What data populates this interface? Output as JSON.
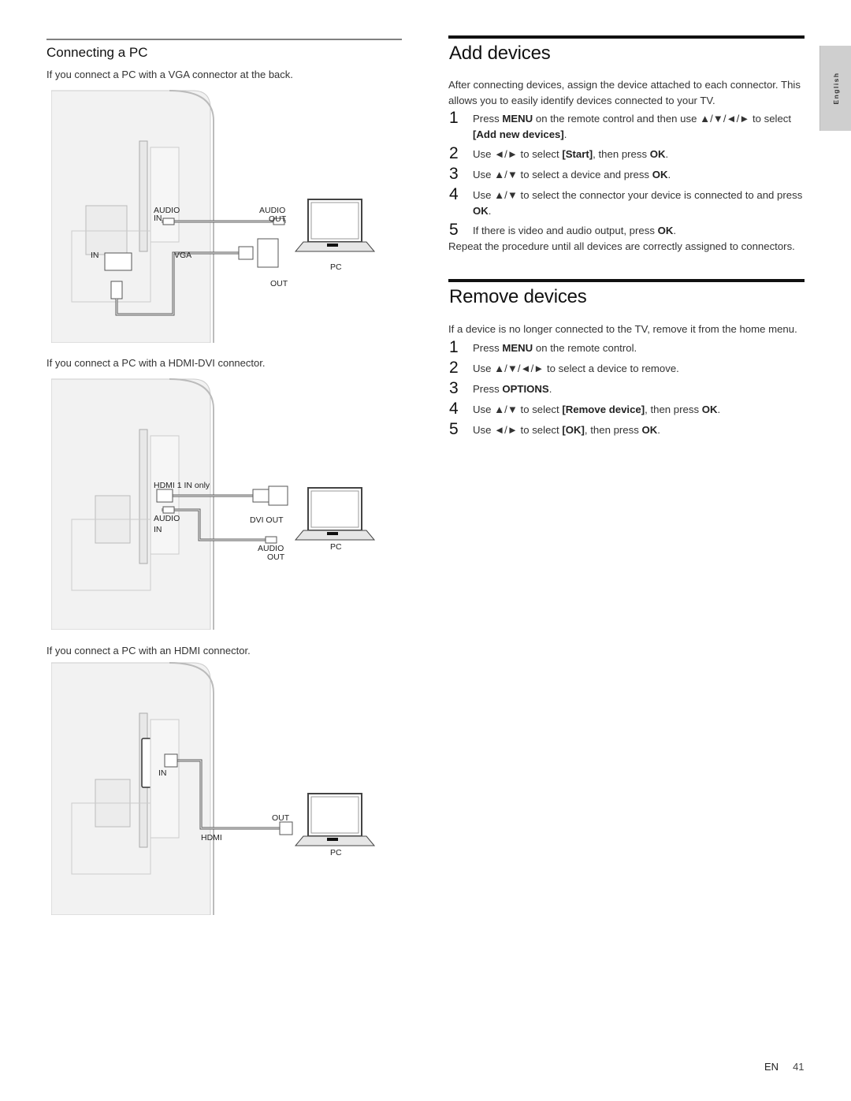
{
  "left": {
    "heading": "Connecting a PC",
    "diagrams": [
      {
        "caption": "If you connect a PC with a VGA connector at the back.",
        "labels": {
          "audio_in_1": "AUDIO",
          "audio_in_2": "IN",
          "audio_out_1": "AUDIO",
          "audio_out_2": "OUT",
          "in": "IN",
          "vga": "VGA",
          "out": "OUT",
          "pc": "PC"
        }
      },
      {
        "caption": "If you connect a PC with a HDMI-DVI connector.",
        "labels": {
          "hdmi": "HDMI 1 IN only",
          "dvi_out": "DVI OUT",
          "audio_in_1": "AUDIO",
          "audio_in_2": "IN",
          "audio_out_1": "AUDIO",
          "audio_out_2": "OUT",
          "pc": "PC"
        }
      },
      {
        "caption": "If you connect a PC with an HDMI connector.",
        "labels": {
          "in": "IN",
          "out": "OUT",
          "hdmi": "HDMI",
          "pc": "PC"
        }
      }
    ]
  },
  "add_devices": {
    "title": "Add devices",
    "intro": "After connecting devices, assign the device attached to each connector. This allows you to easily identify devices connected to your TV.",
    "steps": [
      {
        "num": "1",
        "parts": [
          [
            "t",
            "Press "
          ],
          [
            "b",
            "MENU"
          ],
          [
            "t",
            " on the remote control and then use ▲/▼/◄/► to select "
          ],
          [
            "b",
            "[Add new devices]"
          ],
          [
            "t",
            "."
          ]
        ]
      },
      {
        "num": "2",
        "parts": [
          [
            "t",
            "Use ◄/► to select "
          ],
          [
            "b",
            "[Start]"
          ],
          [
            "t",
            ", then press "
          ],
          [
            "b",
            "OK"
          ],
          [
            "t",
            "."
          ]
        ]
      },
      {
        "num": "3",
        "parts": [
          [
            "t",
            "Use ▲/▼ to select a device and press "
          ],
          [
            "b",
            "OK"
          ],
          [
            "t",
            "."
          ]
        ]
      },
      {
        "num": "4",
        "parts": [
          [
            "t",
            "Use ▲/▼ to select the connector your device is connected to and press "
          ],
          [
            "b",
            "OK"
          ],
          [
            "t",
            "."
          ]
        ]
      },
      {
        "num": "5",
        "parts": [
          [
            "t",
            "If there is video and audio output, press "
          ],
          [
            "b",
            "OK"
          ],
          [
            "t",
            "."
          ]
        ]
      }
    ],
    "outro": "Repeat the procedure until all devices are correctly assigned to connectors."
  },
  "remove_devices": {
    "title": "Remove devices",
    "intro": "If a device is no longer connected to the TV, remove it from the home menu.",
    "steps": [
      {
        "num": "1",
        "parts": [
          [
            "t",
            "Press "
          ],
          [
            "b",
            "MENU"
          ],
          [
            "t",
            " on the remote control."
          ]
        ]
      },
      {
        "num": "2",
        "parts": [
          [
            "t",
            "Use ▲/▼/◄/► to select a device to remove."
          ]
        ]
      },
      {
        "num": "3",
        "parts": [
          [
            "t",
            "Press "
          ],
          [
            "b",
            "OPTIONS"
          ],
          [
            "t",
            "."
          ]
        ]
      },
      {
        "num": "4",
        "parts": [
          [
            "t",
            "Use ▲/▼ to select "
          ],
          [
            "b",
            "[Remove device]"
          ],
          [
            "t",
            ", then press "
          ],
          [
            "b",
            "OK"
          ],
          [
            "t",
            "."
          ]
        ]
      },
      {
        "num": "5",
        "parts": [
          [
            "t",
            "Use ◄/► to select "
          ],
          [
            "b",
            "[OK]"
          ],
          [
            "t",
            ", then press "
          ],
          [
            "b",
            "OK"
          ],
          [
            "t",
            "."
          ]
        ]
      }
    ]
  },
  "side_tab": {
    "label": "English"
  },
  "footer": {
    "lang": "EN",
    "page": "41"
  }
}
